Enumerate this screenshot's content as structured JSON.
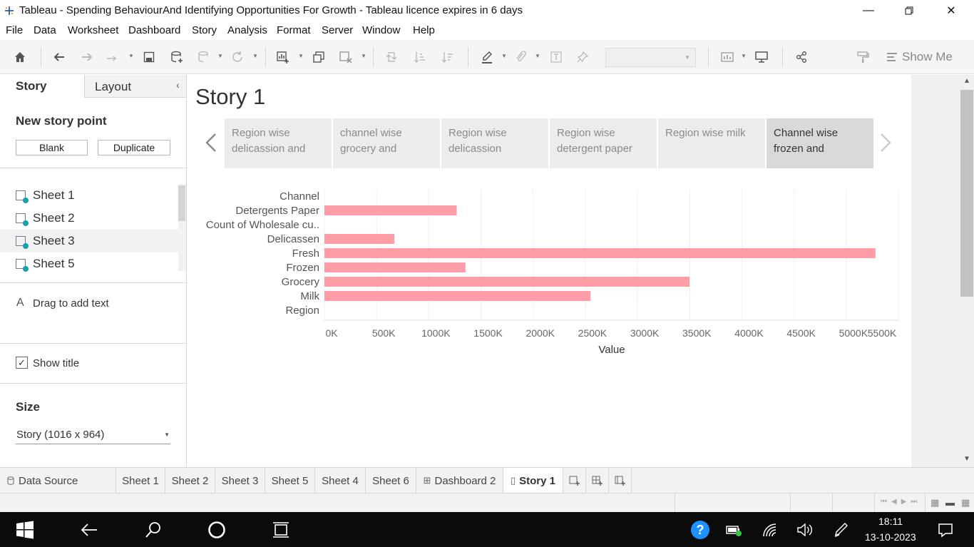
{
  "window": {
    "title": "Tableau - Spending BehaviourAnd Identifying Opportunities For Growth - Tableau licence expires in 6 days"
  },
  "menu": [
    "File",
    "Data",
    "Worksheet",
    "Dashboard",
    "Story",
    "Analysis",
    "Format",
    "Server",
    "Window",
    "Help"
  ],
  "toolbar": {
    "show_me": "Show Me"
  },
  "left_panel": {
    "tab_story": "Story",
    "tab_layout": "Layout",
    "new_story_point": "New story point",
    "blank_button": "Blank",
    "duplicate_button": "Duplicate",
    "sheets": [
      "Sheet 1",
      "Sheet 2",
      "Sheet 3",
      "Sheet 5"
    ],
    "drag_text": "Drag to add text",
    "show_title_label": "Show title",
    "size_heading": "Size",
    "size_value": "Story (1016 x 964)"
  },
  "story": {
    "title": "Story 1",
    "points": [
      {
        "label": "Region wise delicassion and"
      },
      {
        "label": "channel wise grocery and"
      },
      {
        "label": "Region wise delicassion"
      },
      {
        "label": "Region wise detergent paper"
      },
      {
        "label": "Region wise milk"
      },
      {
        "label": "Channel wise frozen and"
      }
    ]
  },
  "chart_data": {
    "type": "bar",
    "orientation": "horizontal",
    "categories": [
      "Channel",
      "Detergents Paper",
      "Count of Wholesale cu..",
      "Delicassen",
      "Fresh",
      "Frozen",
      "Grocery",
      "Milk",
      "Region"
    ],
    "values": [
      0,
      1267857,
      0,
      670943,
      5280131,
      1351650,
      3498562,
      2550357,
      0
    ],
    "xlabel": "Value",
    "xlim": [
      0,
      5500000
    ],
    "xticks": [
      "0K",
      "500K",
      "1000K",
      "1500K",
      "2000K",
      "2500K",
      "3000K",
      "3500K",
      "4000K",
      "4500K",
      "5000K",
      "5500K"
    ],
    "bar_color": "#ff9da7",
    "grid": true
  },
  "sheet_tabs": [
    "Data Source",
    "Sheet 1",
    "Sheet 2",
    "Sheet 3",
    "Sheet 5",
    "Sheet 4",
    "Sheet 6",
    "Dashboard 2",
    "Story 1"
  ],
  "taskbar": {
    "time": "18:11",
    "date": "13-10-2023"
  }
}
